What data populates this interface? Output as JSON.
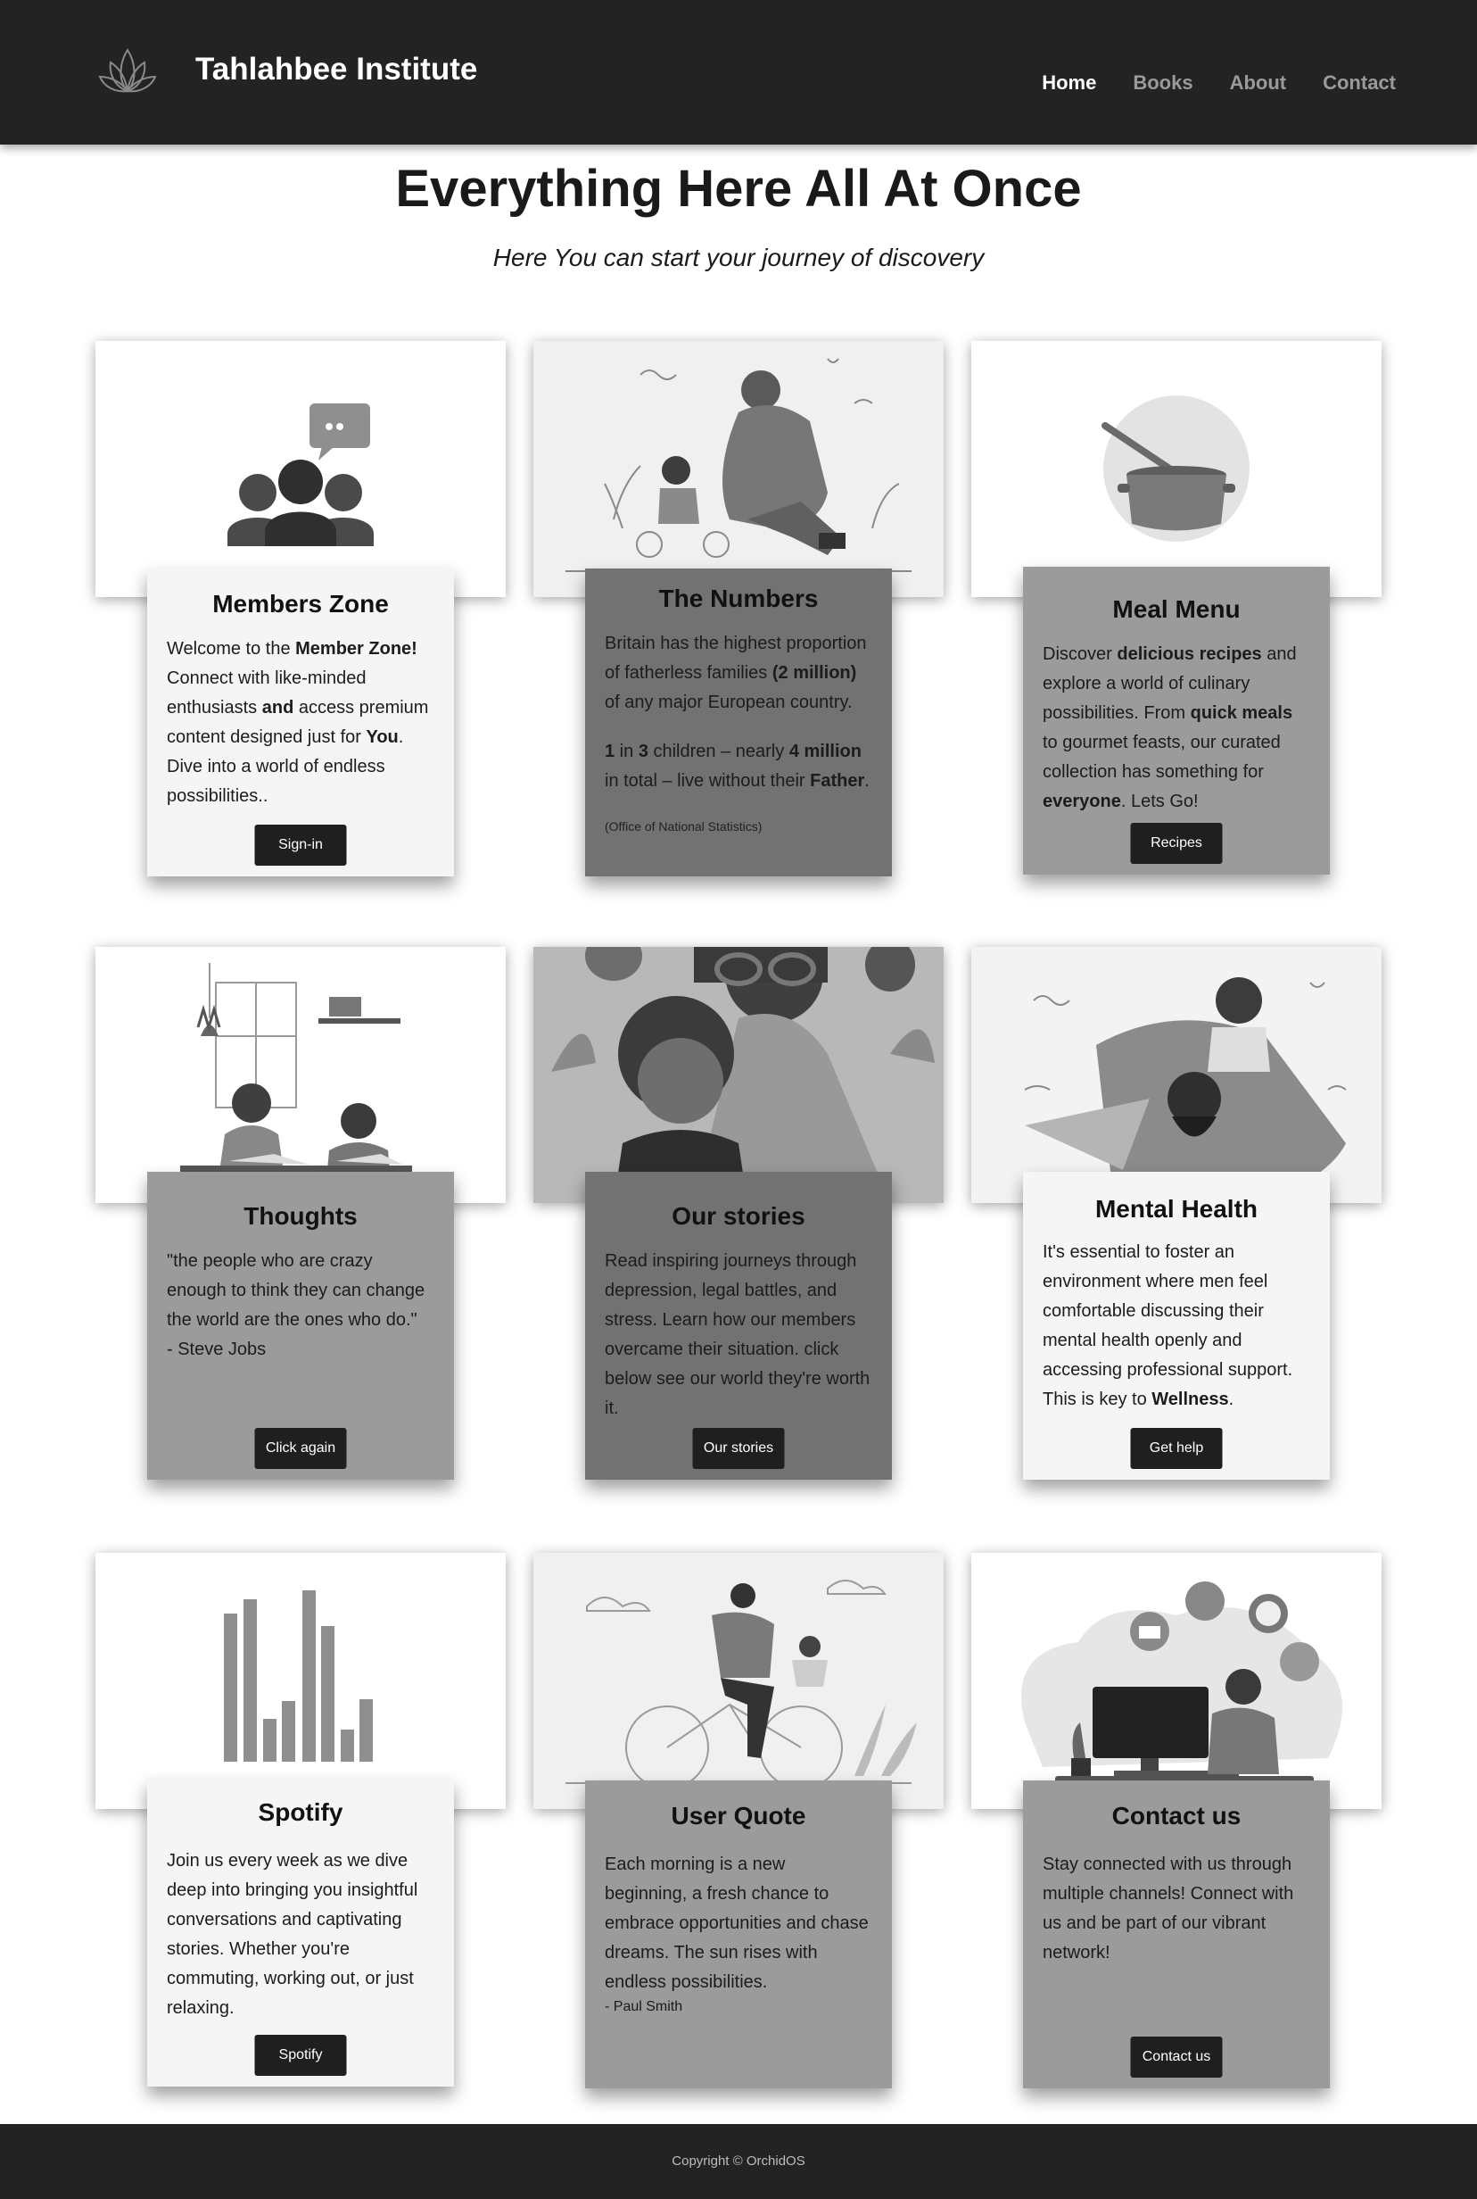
{
  "header": {
    "brand": "Tahlahbee Institute",
    "nav": [
      "Home",
      "Books",
      "About",
      "Contact"
    ],
    "active_nav": "Home",
    "logo_icon": "lotus-icon"
  },
  "hero": {
    "title": "Everything Here All At Once",
    "subtitle": "Here You can start your journey of discovery"
  },
  "cards": [
    {
      "title": "Members Zone",
      "paragraphs": [
        [
          [
            "Welcome to the ",
            false
          ],
          [
            "Member Zone!",
            true
          ],
          [
            " Connect with like-minded enthusiasts ",
            false
          ],
          [
            "and",
            true
          ],
          [
            " access premium content designed just for ",
            false
          ],
          [
            "You",
            true
          ],
          [
            ". Dive into a world of endless possibilities..",
            false
          ]
        ]
      ],
      "button": "Sign-in",
      "image_icon": "community-chat-icon"
    },
    {
      "title": "The Numbers",
      "paragraphs": [
        [
          [
            "Britain has the highest proportion of fatherless families ",
            false
          ],
          [
            "(2 million)",
            true
          ],
          [
            " of any major European country.",
            false
          ]
        ],
        [
          [
            "1",
            true
          ],
          [
            " in ",
            false
          ],
          [
            "3",
            true
          ],
          [
            " children – nearly ",
            false
          ],
          [
            "4 million",
            true
          ],
          [
            " in total – live without their ",
            false
          ],
          [
            "Father",
            true
          ],
          [
            ".",
            false
          ]
        ]
      ],
      "note": "(Office of National Statistics)",
      "image_icon": "father-daughter-bike-illustration"
    },
    {
      "title": "Meal Menu",
      "paragraphs": [
        [
          [
            "Discover ",
            false
          ],
          [
            "delicious recipes",
            true
          ],
          [
            " and explore a world of culinary possibilities. From ",
            false
          ],
          [
            "quick meals",
            true
          ],
          [
            " to gourmet feasts, our curated collection has something for ",
            false
          ],
          [
            "everyone",
            true
          ],
          [
            ". Lets Go!",
            false
          ]
        ]
      ],
      "button": "Recipes",
      "image_icon": "cooking-pot-icon"
    },
    {
      "title": "Thoughts",
      "paragraphs": [
        [
          [
            "\"the people who are crazy enough to think they can change the world are the ones who do.\"",
            false
          ]
        ],
        [
          [
            "- Steve Jobs",
            false
          ]
        ]
      ],
      "button": "Click again",
      "image_icon": "children-studying-illustration"
    },
    {
      "title": "Our stories",
      "paragraphs": [
        [
          [
            "Read inspiring journeys through depression, legal battles, and stress. Learn how our members overcame their situation. click below see our world they're worth it.",
            false
          ]
        ]
      ],
      "button": "Our stories",
      "image_icon": "parent-child-illustration"
    },
    {
      "title": "Mental Health",
      "paragraphs": [
        [
          [
            "It's essential to foster an environment where men feel comfortable discussing their mental health openly and accessing professional support. This is key to ",
            false
          ],
          [
            "Wellness",
            true
          ],
          [
            ".",
            false
          ]
        ]
      ],
      "button": "Get help",
      "image_icon": "father-son-shoulders-illustration"
    },
    {
      "title": "Spotify",
      "paragraphs": [
        [
          [
            "Join us every week as we dive deep into bringing you insightful conversations and captivating stories. Whether you're commuting, working out, or just relaxing.",
            false
          ]
        ]
      ],
      "button": "Spotify",
      "image_icon": "audio-bars-icon"
    },
    {
      "title": "User Quote",
      "paragraphs": [
        [
          [
            "Each morning is a new beginning, a fresh chance to embrace opportunities and chase dreams. The sun rises with endless possibilities.",
            false
          ]
        ]
      ],
      "quote_author": "- Paul Smith",
      "image_icon": "father-child-bicycle-illustration"
    },
    {
      "title": "Contact us",
      "paragraphs": [
        [
          [
            "Stay connected with us through multiple channels! Connect with us and be part of our vibrant network!",
            false
          ]
        ]
      ],
      "button": "Contact us",
      "image_icon": "support-agent-illustration"
    }
  ],
  "footer": {
    "copyright": "Copyright © OrchidOS"
  }
}
